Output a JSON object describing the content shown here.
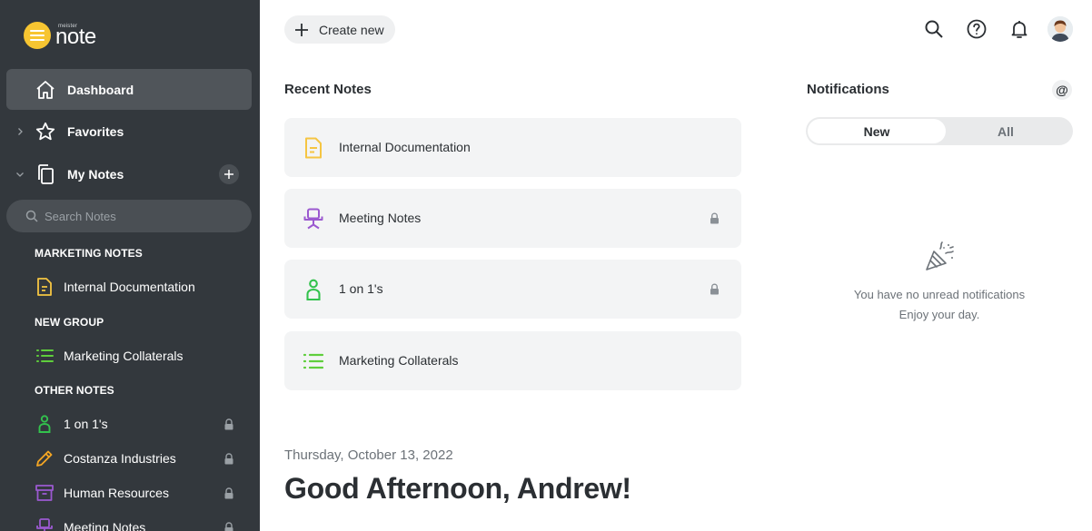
{
  "app": {
    "logo_small": "meister",
    "logo_big": "note"
  },
  "sidebar": {
    "nav": [
      {
        "label": "Dashboard"
      },
      {
        "label": "Favorites"
      },
      {
        "label": "My Notes"
      }
    ],
    "search": {
      "placeholder": "Search Notes"
    },
    "groups": [
      {
        "title": "MARKETING NOTES",
        "items": [
          {
            "label": "Internal Documentation",
            "icon": "document-icon",
            "color": "#f5c542"
          }
        ]
      },
      {
        "title": "NEW GROUP",
        "items": [
          {
            "label": "Marketing Collaterals",
            "icon": "list-icon",
            "color": "#5fce3c"
          }
        ]
      },
      {
        "title": "OTHER NOTES",
        "items": [
          {
            "label": "1 on 1's",
            "icon": "person-icon",
            "color": "#33c24d",
            "locked": true
          },
          {
            "label": "Costanza Industries",
            "icon": "pencil-icon",
            "color": "#f5a623",
            "locked": true
          },
          {
            "label": "Human Resources",
            "icon": "archive-box-icon",
            "color": "#9b59d0",
            "locked": true
          },
          {
            "label": "Meeting Notes",
            "icon": "chair-icon",
            "color": "#9b59d0",
            "locked": true
          }
        ]
      }
    ]
  },
  "toolbar": {
    "create_label": "Create new"
  },
  "recent": {
    "title": "Recent Notes",
    "cards": [
      {
        "label": "Internal Documentation",
        "icon": "document-icon",
        "locked": false
      },
      {
        "label": "Meeting Notes",
        "icon": "chair-icon",
        "locked": true
      },
      {
        "label": "1 on 1's",
        "icon": "person-icon",
        "locked": true
      },
      {
        "label": "Marketing Collaterals",
        "icon": "list-icon",
        "locked": false
      }
    ]
  },
  "greeting": {
    "date": "Thursday, October 13, 2022",
    "text": "Good Afternoon, Andrew!"
  },
  "notifications": {
    "title": "Notifications",
    "mention_symbol": "@",
    "tabs": [
      {
        "label": "New",
        "active": true
      },
      {
        "label": "All",
        "active": false
      }
    ],
    "empty_line1": "You have no unread notifications",
    "empty_line2": "Enjoy your day."
  },
  "colors": {
    "sidebar_bg": "#33383d",
    "accent_yellow": "#f7c531",
    "green": "#5fce3c",
    "purple": "#9b59d0"
  }
}
